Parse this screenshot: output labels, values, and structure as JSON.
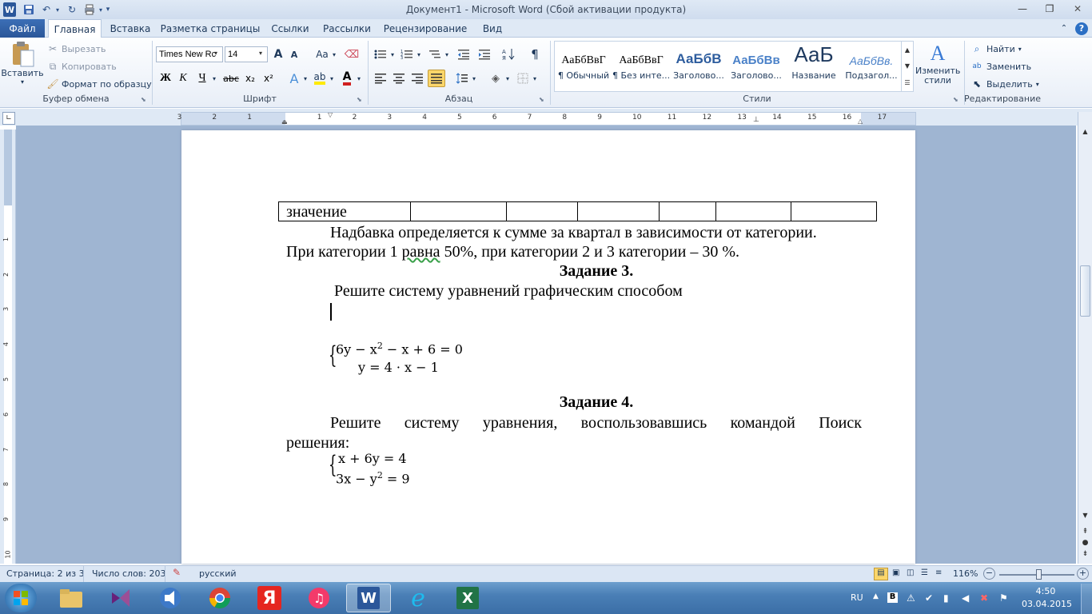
{
  "window": {
    "title": "Документ1  -  Microsoft Word (Сбой активации продукта)",
    "qat_undo_icon": "undo-icon",
    "qat_redo_icon": "redo-icon"
  },
  "tabs": [
    {
      "label": "Файл"
    },
    {
      "label": "Главная"
    },
    {
      "label": "Вставка"
    },
    {
      "label": "Разметка страницы"
    },
    {
      "label": "Ссылки"
    },
    {
      "label": "Рассылки"
    },
    {
      "label": "Рецензирование"
    },
    {
      "label": "Вид"
    }
  ],
  "clipboard": {
    "paste": "Вставить",
    "cut": "Вырезать",
    "copy": "Копировать",
    "format_painter": "Формат по образцу",
    "group": "Буфер обмена"
  },
  "font": {
    "name": "Times New Rc",
    "size": "14",
    "group": "Шрифт",
    "bold": "Ж",
    "italic": "К",
    "underline": "Ч",
    "strike": "abc",
    "subscript": "x₂",
    "superscript": "x²",
    "grow": "A",
    "shrink": "A",
    "case": "Aa"
  },
  "paragraph": {
    "group": "Абзац",
    "pilcrow": "¶"
  },
  "styles": {
    "group": "Стили",
    "items": [
      {
        "sample": "АаБбВвГ",
        "name": "¶ Обычный"
      },
      {
        "sample": "АаБбВвГ",
        "name": "¶ Без инте..."
      },
      {
        "sample": "АаБбВ",
        "name": "Заголово..."
      },
      {
        "sample": "АаБбВв",
        "name": "Заголово..."
      },
      {
        "sample": "АаБ",
        "name": "Название"
      },
      {
        "sample": "АаБбВв.",
        "name": "Подзагол..."
      }
    ],
    "change": "Изменить стили"
  },
  "editing": {
    "group": "Редактирование",
    "find": "Найти",
    "replace": "Заменить",
    "select": "Выделить"
  },
  "ruler": {
    "h_labels": [
      "3",
      "2",
      "1",
      "1",
      "2",
      "3",
      "4",
      "5",
      "6",
      "7",
      "8",
      "9",
      "10",
      "11",
      "12",
      "13",
      "14",
      "15",
      "16",
      "17"
    ],
    "v_labels": [
      "1",
      "2",
      "3",
      "4",
      "5",
      "6",
      "7",
      "8",
      "9",
      "10"
    ]
  },
  "document": {
    "table_cell": "значение",
    "p1_line1": "Надбавка определяется к сумме за квартал в зависимости от категории.",
    "p1_line2_a": "При категории 1 ",
    "p1_line2_b": "равна",
    "p1_line2_c": " 50%, при категории 2 и 3 категории – 30 %.",
    "task3": "Задание 3.",
    "task3_text": "Решите систему уравнений графическим способом",
    "eq1_a": "6y − x",
    "eq1_exp": "2",
    "eq1_b": " − x + 6 = 0",
    "eq2": "y = 4 · x − 1",
    "task4": "Задание 4.",
    "task4_line1": [
      "Решите",
      "систему",
      "уравнения,",
      "воспользовавшись",
      "командой",
      "Поиск"
    ],
    "task4_line2": "решения:",
    "eq3": "x + 6y = 4",
    "eq4_a": "3x − y",
    "eq4_exp": "2",
    "eq4_b": " = 9"
  },
  "status": {
    "page": "Страница: 2 из 3",
    "words": "Число слов: 203",
    "lang": "русский",
    "zoom": "116%",
    "zoom_level_percent": 116
  },
  "taskbar": {
    "lang": "RU",
    "time": "4:50",
    "date": "03.04.2015",
    "apps": [
      "file-explorer",
      "visual-studio",
      "media-player",
      "chrome",
      "yandex",
      "itunes",
      "word",
      "internet-explorer",
      "excel"
    ]
  },
  "colors": {
    "file_tab": "#2b579a",
    "ribbon_bg": "#f3f6fb",
    "doc_bg": "#9fb5d2",
    "taskbar": "#4a7fb6"
  }
}
